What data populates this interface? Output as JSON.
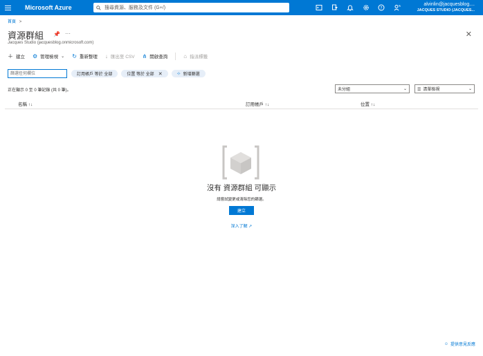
{
  "header": {
    "brand": "Microsoft Azure",
    "search_placeholder": "搜尋資源、服務及文件 (G+/)",
    "icons": [
      "cloud-shell-icon",
      "directory-filter-icon",
      "notification-bell-icon",
      "settings-gear-icon",
      "help-icon",
      "feedback-icon"
    ],
    "account_email": "alvinlin@jacquesblog....",
    "account_tenant": "JACQUES STUDIO (JACQUES..."
  },
  "breadcrumb": {
    "home": "首頁",
    "separator": ">"
  },
  "page": {
    "title": "資源群組",
    "subtitle": "Jacques Studio (jacquesblog.onmicrosoft.com)"
  },
  "toolbar": {
    "create": "建立",
    "manage_view": "管理檢視",
    "refresh": "重新整理",
    "export_csv": "匯出至 CSV",
    "open_query": "開啟查詢",
    "assign_tags": "指派標籤"
  },
  "filters": {
    "search_placeholder": "篩選任何欄位",
    "subscription": "訂用帳戶 等於 全部",
    "location": "位置 等於 全部",
    "add_filter": "新增篩選"
  },
  "list": {
    "record_count": "正在顯示 0 至 0 筆記錄 (共 0 筆)。",
    "group_by": "未分組",
    "view_mode": "清單檢視",
    "columns": [
      "名稱 ↑↓",
      "訂用帳戶 ↑↓",
      "位置 ↑↓"
    ]
  },
  "empty_state": {
    "title": "沒有 資源群組 可顯示",
    "subtitle": "請嘗試變更或清除您的篩選。",
    "create_button": "建立",
    "learn_more": "深入了解 ↗"
  },
  "footer": {
    "feedback": "提供意見反應"
  },
  "colors": {
    "accent": "#0078d4",
    "pill_bg": "#e6eef8"
  }
}
